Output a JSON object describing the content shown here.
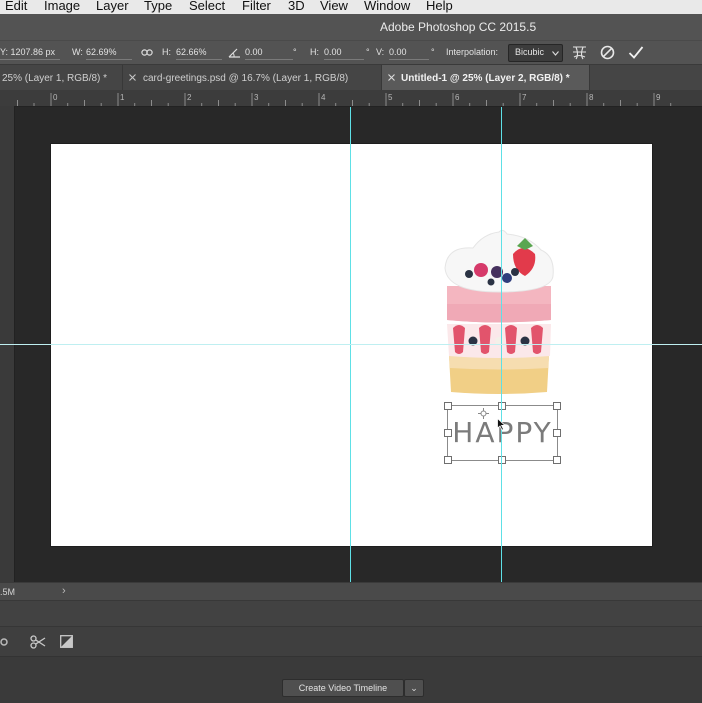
{
  "menu": {
    "items": [
      "Edit",
      "Image",
      "Layer",
      "Type",
      "Select",
      "Filter",
      "3D",
      "View",
      "Window",
      "Help"
    ]
  },
  "window": {
    "title": "Adobe Photoshop CC 2015.5"
  },
  "options": {
    "y_value": "Y: 1207.86 px",
    "w_label": "W:",
    "w_value": "62.69%",
    "h_label": "H:",
    "h_value": "62.66%",
    "angle_value": "0.00",
    "angle_unit": "°",
    "skew_h_label": "H:",
    "skew_h_value": "0.00",
    "skew_h_unit": "°",
    "skew_v_label": "V:",
    "skew_v_value": "0.00",
    "skew_v_unit": "°",
    "interpolation_label": "Interpolation:",
    "interpolation_value": "Bicubic"
  },
  "tabs": [
    {
      "label": "25% (Layer 1, RGB/8) *",
      "active": false
    },
    {
      "label": "card-greetings.psd @ 16.7% (Layer 1, RGB/8)",
      "active": false
    },
    {
      "label": "Untitled-1 @ 25% (Layer 2, RGB/8) *",
      "active": true
    }
  ],
  "ruler": {
    "numbers": [
      "0",
      "1",
      "2",
      "3",
      "4",
      "5",
      "6",
      "7",
      "8",
      "9"
    ]
  },
  "canvas": {
    "happy_text": "HAPPY"
  },
  "status": {
    "doc_size": ".5M",
    "arrow": "›"
  },
  "timeline": {
    "create_button": "Create Video Timeline",
    "dropdown_arrow": "⌄"
  },
  "colors": {
    "guide": "#5ee0e6",
    "canvas": "#ffffff",
    "workspace": "#282828",
    "chrome": "#535353"
  },
  "icons": [
    "link-icon",
    "angle-icon",
    "warp-icon",
    "cancel-transform-icon",
    "commit-transform-icon",
    "split-clip-icon",
    "transition-icon",
    "settings-icon",
    "close-tab-icon"
  ]
}
